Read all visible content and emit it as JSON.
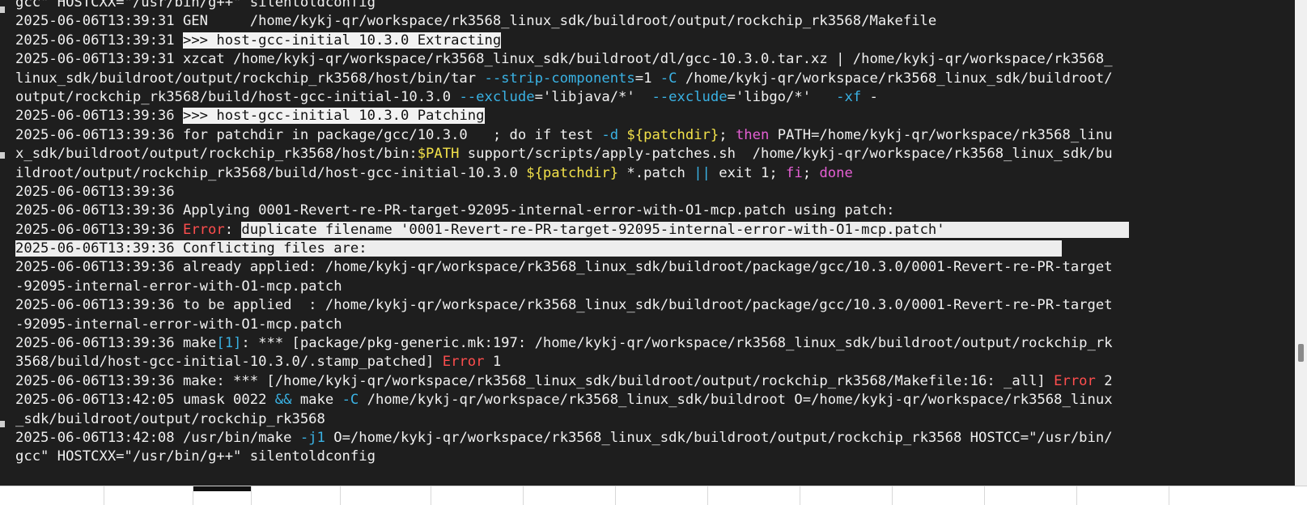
{
  "terminal": {
    "lines": [
      [
        {
          "t": "gcc\" HOSTCXX=\"/usr/bin/g++\" silentoldconfig"
        }
      ],
      [
        {
          "t": "2025-06-06T13:39:31 GEN     /home/kykj-qr/workspace/rk3568_linux_sdk/buildroot/output/rockchip_rk3568/Makefile"
        }
      ],
      [
        {
          "t": "2025-06-06T13:39:31 "
        },
        {
          "t": ">>> host-gcc-initial 10.3.0 Extracting",
          "c": "hl"
        }
      ],
      [
        {
          "t": "2025-06-06T13:39:31 xzcat /home/kykj-qr/workspace/rk3568_linux_sdk/buildroot/dl/gcc-10.3.0.tar.xz | /home/kykj-qr/workspace/rk3568_"
        }
      ],
      [
        {
          "t": "linux_sdk/buildroot/output/rockchip_rk3568/host/bin/tar "
        },
        {
          "t": "--strip-components",
          "c": "cyan"
        },
        {
          "t": "=1 "
        },
        {
          "t": "-C",
          "c": "cyan"
        },
        {
          "t": " /home/kykj-qr/workspace/rk3568_linux_sdk/buildroot/"
        }
      ],
      [
        {
          "t": "output/rockchip_rk3568/build/host-gcc-initial-10.3.0 "
        },
        {
          "t": "--exclude",
          "c": "cyan"
        },
        {
          "t": "='libjava/*'  "
        },
        {
          "t": "--exclude",
          "c": "cyan"
        },
        {
          "t": "='libgo/*'   "
        },
        {
          "t": "-xf",
          "c": "cyan"
        },
        {
          "t": " -"
        }
      ],
      [
        {
          "t": "2025-06-06T13:39:36 "
        },
        {
          "t": ">>> host-gcc-initial 10.3.0 Patching",
          "c": "hl"
        }
      ],
      [
        {
          "t": "2025-06-06T13:39:36 for patchdir in package/gcc/10.3.0   ; do if test "
        },
        {
          "t": "-d",
          "c": "cyan"
        },
        {
          "t": " "
        },
        {
          "t": "${patchdir}",
          "c": "yellow"
        },
        {
          "t": "; "
        },
        {
          "t": "then",
          "c": "magenta"
        },
        {
          "t": " PATH=/home/kykj-qr/workspace/rk3568_linu"
        }
      ],
      [
        {
          "t": "x_sdk/buildroot/output/rockchip_rk3568/host/bin:"
        },
        {
          "t": "$PATH",
          "c": "yellow"
        },
        {
          "t": " support/scripts/apply-patches.sh  /home/kykj-qr/workspace/rk3568_linux_sdk/bu"
        }
      ],
      [
        {
          "t": "ildroot/output/rockchip_rk3568/build/host-gcc-initial-10.3.0 "
        },
        {
          "t": "${patchdir}",
          "c": "yellow"
        },
        {
          "t": " *.patch "
        },
        {
          "t": "||",
          "c": "cyan"
        },
        {
          "t": " exit 1; "
        },
        {
          "t": "fi",
          "c": "magenta"
        },
        {
          "t": "; "
        },
        {
          "t": "done",
          "c": "magenta"
        }
      ],
      [
        {
          "t": "2025-06-06T13:39:36"
        }
      ],
      [
        {
          "t": "2025-06-06T13:39:36 Applying 0001-Revert-re-PR-target-92095-internal-error-with-O1-mcp.patch using patch:"
        }
      ],
      [
        {
          "t": "2025-06-06T13:39:36 "
        },
        {
          "t": "Error",
          "c": "red"
        },
        {
          "t": ": "
        },
        {
          "t": "duplicate filename '0001-Revert-re-PR-target-92095-internal-error-with-O1-mcp.patch'                      ",
          "c": "hlfull"
        }
      ],
      [
        {
          "t": "2025-06-06T13:39:36 Conflicting files are:                                                                                   ",
          "c": "hlfull"
        }
      ],
      [
        {
          "t": "2025-06-06T13:39:36 already applied: /home/kykj-qr/workspace/rk3568_linux_sdk/buildroot/package/gcc/10.3.0/0001-Revert-re-PR-target"
        }
      ],
      [
        {
          "t": "-92095-internal-error-with-O1-mcp.patch"
        }
      ],
      [
        {
          "t": "2025-06-06T13:39:36 to be applied  : /home/kykj-qr/workspace/rk3568_linux_sdk/buildroot/package/gcc/10.3.0/0001-Revert-re-PR-target"
        }
      ],
      [
        {
          "t": "-92095-internal-error-with-O1-mcp.patch"
        }
      ],
      [
        {
          "t": "2025-06-06T13:39:36 make"
        },
        {
          "t": "[1]",
          "c": "cyan"
        },
        {
          "t": ": *** [package/pkg-generic.mk:197: /home/kykj-qr/workspace/rk3568_linux_sdk/buildroot/output/rockchip_rk"
        }
      ],
      [
        {
          "t": "3568/build/host-gcc-initial-10.3.0/.stamp_patched] "
        },
        {
          "t": "Error",
          "c": "red"
        },
        {
          "t": " 1"
        }
      ],
      [
        {
          "t": "2025-06-06T13:39:36 make: *** [/home/kykj-qr/workspace/rk3568_linux_sdk/buildroot/output/rockchip_rk3568/Makefile:16: _all] "
        },
        {
          "t": "Error",
          "c": "red"
        },
        {
          "t": " 2"
        }
      ],
      [
        {
          "t": "2025-06-06T13:42:05 umask 0022 "
        },
        {
          "t": "&&",
          "c": "cyan"
        },
        {
          "t": " make "
        },
        {
          "t": "-C",
          "c": "cyan"
        },
        {
          "t": " /home/kykj-qr/workspace/rk3568_linux_sdk/buildroot O=/home/kykj-qr/workspace/rk3568_linux"
        }
      ],
      [
        {
          "t": "_sdk/buildroot/output/rockchip_rk3568"
        }
      ],
      [
        {
          "t": "2025-06-06T13:42:08 /usr/bin/make "
        },
        {
          "t": "-j1",
          "c": "cyan"
        },
        {
          "t": " O=/home/kykj-qr/workspace/rk3568_linux_sdk/buildroot/output/rockchip_rk3568 HOSTCC=\"/usr/bin/"
        }
      ],
      [
        {
          "t": "gcc\" HOSTCXX=\"/usr/bin/g++\" silentoldconfig"
        }
      ]
    ]
  },
  "colors": {
    "background": "#1e1e1e",
    "text": "#f0f0f0",
    "cyan": "#3ab2e4",
    "magenta": "#e55fd4",
    "yellow": "#f3e24a",
    "red": "#ff4e4e",
    "highlight": "#f2f2f2"
  }
}
